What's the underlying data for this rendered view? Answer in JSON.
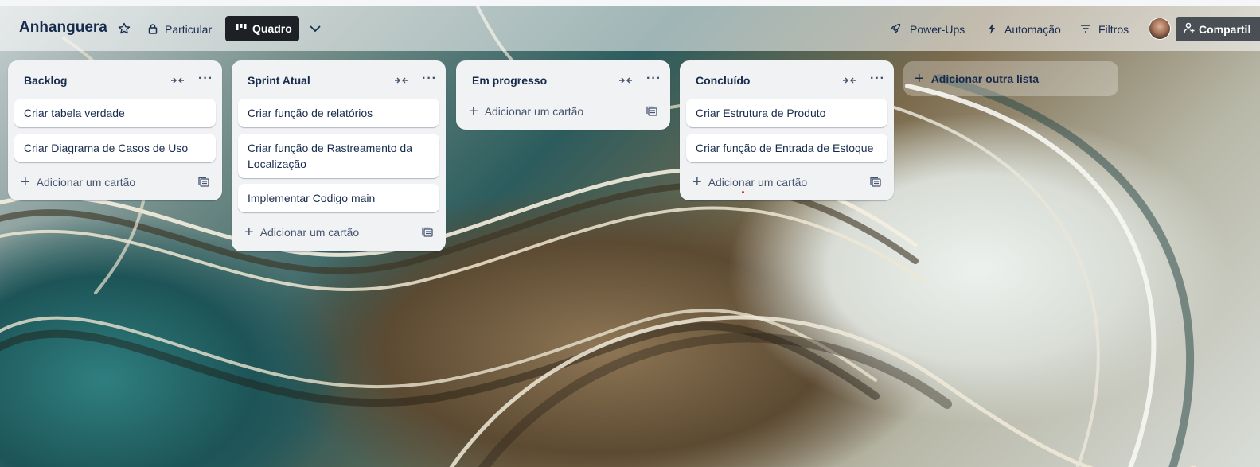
{
  "header": {
    "board_name": "Anhanguera",
    "visibility_label": "Particular",
    "view_label": "Quadro",
    "powerups_label": "Power-Ups",
    "automation_label": "Automação",
    "filters_label": "Filtros",
    "share_label": "Compartil"
  },
  "lists": [
    {
      "title": "Backlog",
      "cards": [
        "Criar tabela verdade",
        "Criar Diagrama de Casos de Uso"
      ],
      "add_card_label": "Adicionar um cartão"
    },
    {
      "title": "Sprint Atual",
      "cards": [
        "Criar função de relatórios",
        "Criar função de Rastreamento da Localização",
        "Implementar Codigo main"
      ],
      "add_card_label": "Adicionar um cartão"
    },
    {
      "title": "Em progresso",
      "cards": [],
      "add_card_label": "Adicionar um cartão"
    },
    {
      "title": "Concluído",
      "cards": [
        "Criar Estrutura de Produto",
        "Criar função de Entrada de Estoque"
      ],
      "add_card_label": "Adicionar um cartão"
    }
  ],
  "add_list_label": "Adicionar outra lista",
  "icons": {
    "star": "star-icon",
    "lock": "lock-icon",
    "board": "board-icon",
    "chevron": "chevron-down-icon",
    "rocket": "rocket-icon",
    "bolt": "bolt-icon",
    "filter": "filter-icon",
    "collapse": "collapse-list-icon",
    "menu": "more-icon",
    "template": "template-icon",
    "person_add": "person-add-icon"
  }
}
